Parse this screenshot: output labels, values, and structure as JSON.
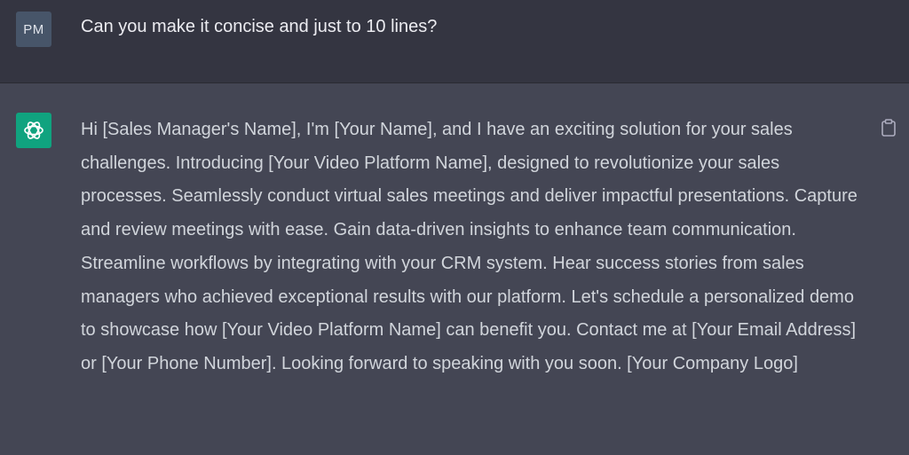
{
  "user_message": {
    "avatar_initials": "PM",
    "text": "Can you make it concise and just to 10 lines?"
  },
  "assistant_message": {
    "avatar_icon": "openai-logo-icon",
    "text": "Hi [Sales Manager's Name], I'm [Your Name], and I have an exciting solution for your sales challenges. Introducing [Your Video Platform Name], designed to revolutionize your sales processes. Seamlessly conduct virtual sales meetings and deliver impactful presentations. Capture and review meetings with ease. Gain data-driven insights to enhance team communication. Streamline workflows by integrating with your CRM system. Hear success stories from sales managers who achieved exceptional results with our platform. Let's schedule a personalized demo to showcase how [Your Video Platform Name] can benefit you. Contact me at [Your Email Address] or [Your Phone Number]. Looking forward to speaking with you soon. [Your Company Logo]",
    "copy_icon": "clipboard-icon"
  },
  "colors": {
    "user_bg": "#343541",
    "assistant_bg": "#444654",
    "user_avatar_bg": "#475569",
    "assistant_avatar_bg": "#10a37f",
    "text": "#d1d5db"
  }
}
